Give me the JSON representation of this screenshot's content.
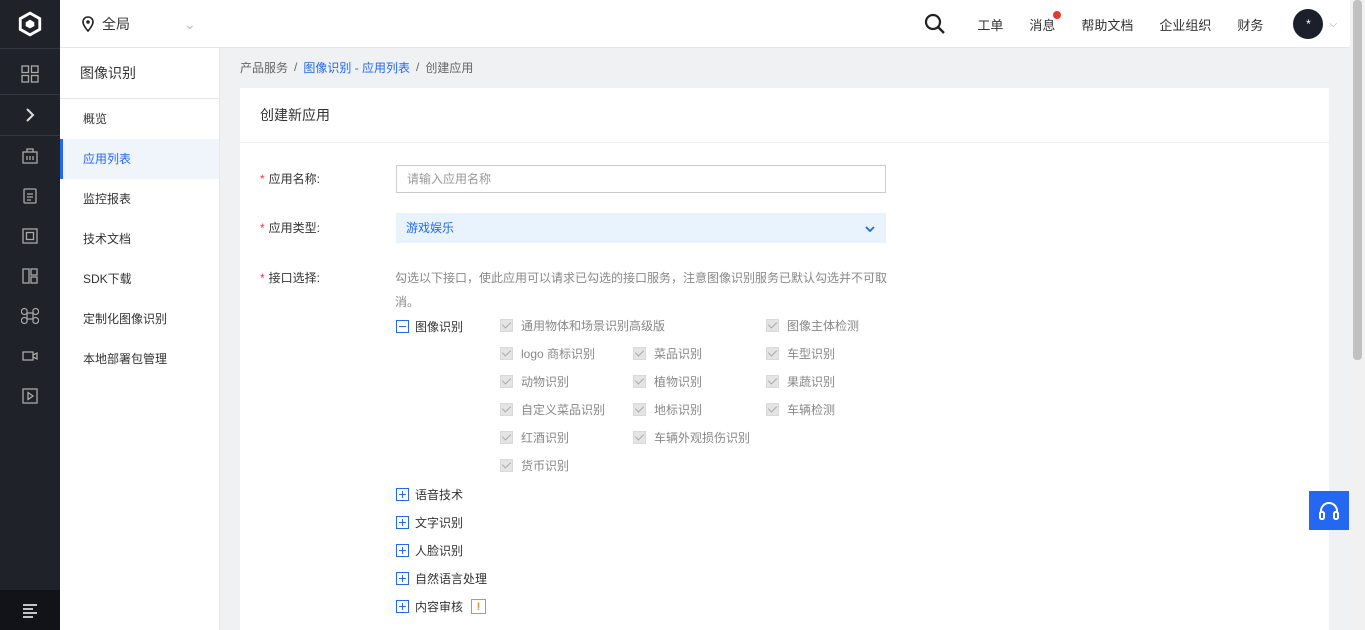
{
  "header": {
    "region": "全局",
    "nav": [
      "工单",
      "消息",
      "帮助文档",
      "企业组织",
      "财务"
    ],
    "avatar_text": "*"
  },
  "rail_icons": [
    "grid-icon",
    "expand-icon",
    "building-icon",
    "report-icon",
    "frame-icon",
    "layout-icon",
    "command-icon",
    "video-icon",
    "play-icon"
  ],
  "sidebar": {
    "title": "图像识别",
    "items": [
      {
        "label": "概览"
      },
      {
        "label": "应用列表"
      },
      {
        "label": "监控报表"
      },
      {
        "label": "技术文档"
      },
      {
        "label": "SDK下载"
      },
      {
        "label": "定制化图像识别"
      },
      {
        "label": "本地部署包管理"
      }
    ],
    "active_index": 1
  },
  "breadcrumb": {
    "root": "产品服务",
    "sep": "/",
    "link": "图像识别 - 应用列表",
    "current": "创建应用"
  },
  "form": {
    "title": "创建新应用",
    "required_mark": "*",
    "name_label": "应用名称:",
    "name_placeholder": "请输入应用名称",
    "type_label": "应用类型:",
    "type_value": "游戏娱乐",
    "api_label": "接口选择:",
    "api_hint": "勾选以下接口，使此应用可以请求已勾选的接口服务，注意图像识别服务已默认勾选并不可取消。",
    "image_group": "图像识别",
    "image_apis": [
      "通用物体和场景识别高级版",
      "图像主体检测",
      "logo 商标识别",
      "菜品识别",
      "车型识别",
      "动物识别",
      "植物识别",
      "果蔬识别",
      "自定义菜品识别",
      "地标识别",
      "车辆检测",
      "红酒识别",
      "车辆外观损伤识别",
      "货币识别"
    ],
    "other_groups": [
      "语音技术",
      "文字识别",
      "人脸识别",
      "自然语言处理",
      "内容审核"
    ],
    "warn_mark": "!"
  }
}
